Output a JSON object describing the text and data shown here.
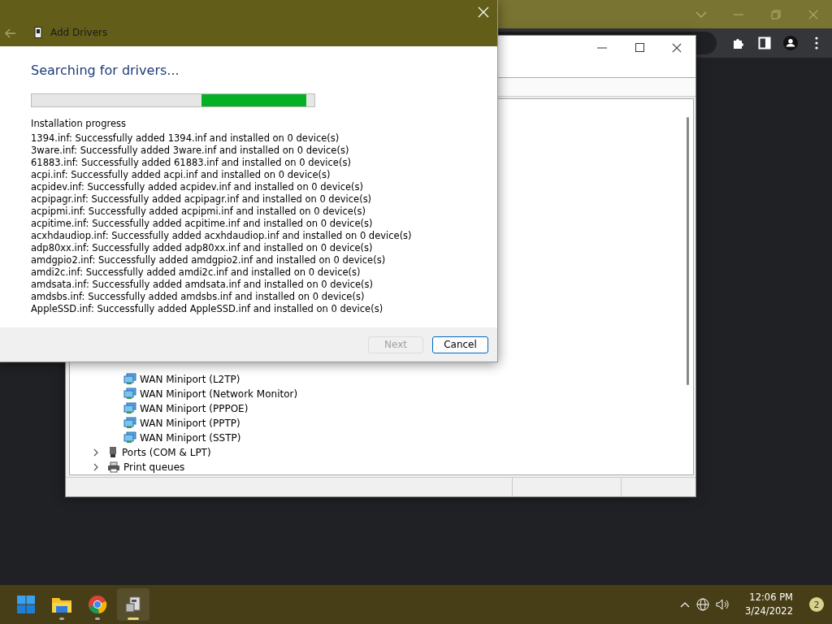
{
  "dialog": {
    "title": "Add Drivers",
    "heading": "Searching for drivers...",
    "log_label": "Installation progress",
    "log_lines": [
      "1394.inf: Successfully added 1394.inf and installed on 0 device(s)",
      "3ware.inf: Successfully added 3ware.inf and installed on 0 device(s)",
      "61883.inf: Successfully added 61883.inf and installed on 0 device(s)",
      "acpi.inf: Successfully added acpi.inf and installed on 0 device(s)",
      "acpidev.inf: Successfully added acpidev.inf and installed on 0 device(s)",
      "acpipagr.inf: Successfully added acpipagr.inf and installed on 0 device(s)",
      "acpipmi.inf: Successfully added acpipmi.inf and installed on 0 device(s)",
      "acpitime.inf: Successfully added acpitime.inf and installed on 0 device(s)",
      "acxhdaudiop.inf: Successfully added acxhdaudiop.inf and installed on 0 device(s)",
      "adp80xx.inf: Successfully added adp80xx.inf and installed on 0 device(s)",
      "amdgpio2.inf: Successfully added amdgpio2.inf and installed on 0 device(s)",
      "amdi2c.inf: Successfully added amdi2c.inf and installed on 0 device(s)",
      "amdsata.inf: Successfully added amdsata.inf and installed on 0 device(s)",
      "amdsbs.inf: Successfully added amdsbs.inf and installed on 0 device(s)",
      "AppleSSD.inf: Successfully added AppleSSD.inf and installed on 0 device(s)"
    ],
    "buttons": [
      {
        "label": "Next",
        "disabled": true
      },
      {
        "label": "Cancel",
        "disabled": false
      }
    ]
  },
  "device_manager": {
    "tree": [
      {
        "label": "WAN Miniport (L2TP)",
        "kind": "device"
      },
      {
        "label": "WAN Miniport (Network Monitor)",
        "kind": "device"
      },
      {
        "label": "WAN Miniport (PPPOE)",
        "kind": "device"
      },
      {
        "label": "WAN Miniport (PPTP)",
        "kind": "device"
      },
      {
        "label": "WAN Miniport (SSTP)",
        "kind": "device"
      },
      {
        "label": "Ports (COM & LPT)",
        "kind": "category",
        "expanded": false
      },
      {
        "label": "Print queues",
        "kind": "category",
        "expanded": false
      }
    ]
  },
  "taskbar": {
    "apps": [
      {
        "selected": false,
        "running": false
      },
      {
        "selected": false,
        "running": true
      },
      {
        "selected": false,
        "running": true
      },
      {
        "selected": true,
        "running": true
      }
    ],
    "time": "12:06 PM",
    "date": "3/24/2022",
    "notifications": "2"
  }
}
